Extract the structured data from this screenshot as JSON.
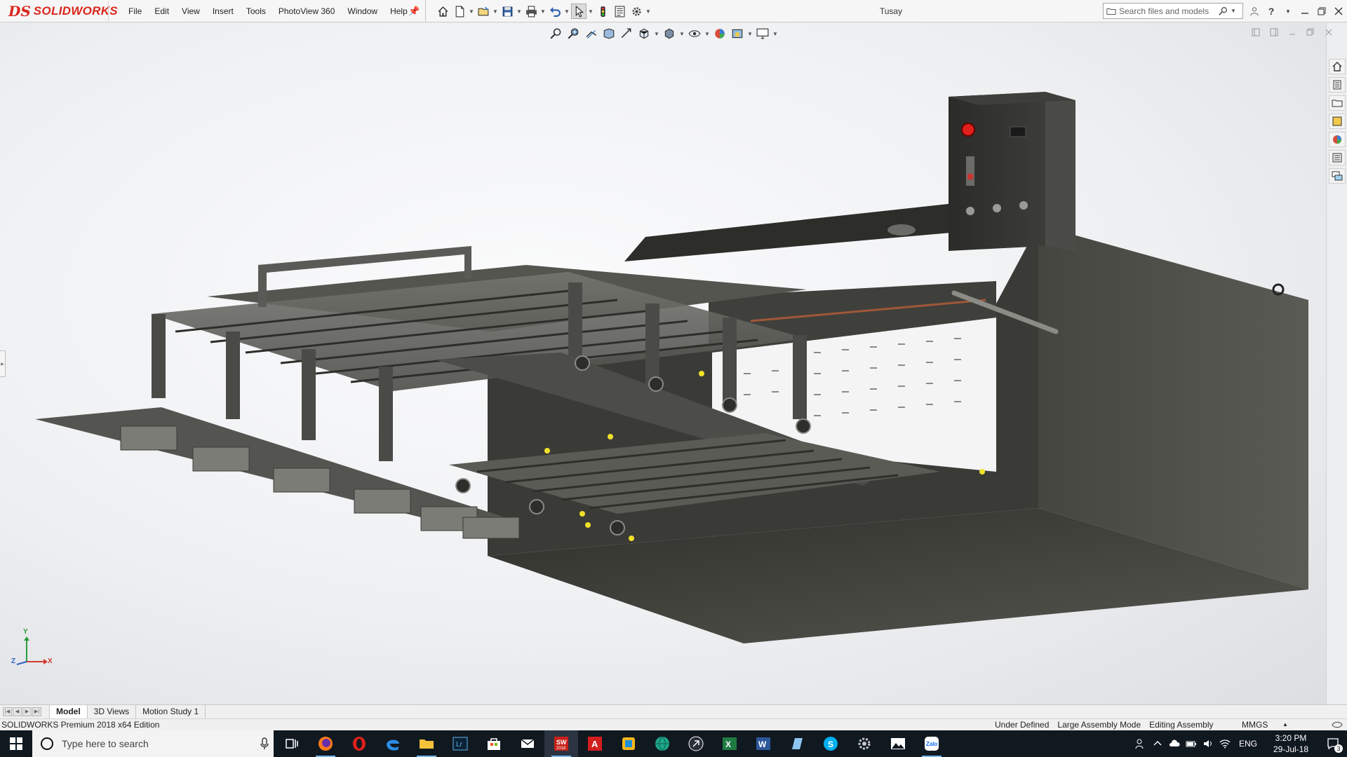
{
  "app": {
    "brand_prefix": "DS",
    "brand_name": "SOLIDWORKS",
    "document_title": "Tusay"
  },
  "menu": {
    "items": [
      "File",
      "Edit",
      "View",
      "Insert",
      "Tools",
      "PhotoView 360",
      "Window",
      "Help"
    ]
  },
  "search": {
    "placeholder": "Search files and models"
  },
  "bottom_tabs": {
    "items": [
      "Model",
      "3D Views",
      "Motion Study 1"
    ],
    "active": "Model"
  },
  "status": {
    "edition": "SOLIDWORKS Premium 2018 x64 Edition",
    "state": "Under Defined",
    "mode": "Large Assembly Mode",
    "editing": "Editing Assembly",
    "units": "MMGS"
  },
  "triad": {
    "y": "Y",
    "x": "X",
    "z": "Z"
  },
  "taskbar": {
    "search_placeholder": "Type here to search",
    "sw_badge": "SW\n2018",
    "lang": "ENG",
    "time": "3:20 PM",
    "date": "29-Jul-18",
    "notification_count": "3"
  },
  "colors": {
    "brand": "#d9271d",
    "taskbar": "#101820",
    "model_dark": "#3b3b38",
    "model_frame": "#5e5f5a",
    "indicator_red": "#e0201b",
    "highlight_yellow": "#f1e12a"
  }
}
